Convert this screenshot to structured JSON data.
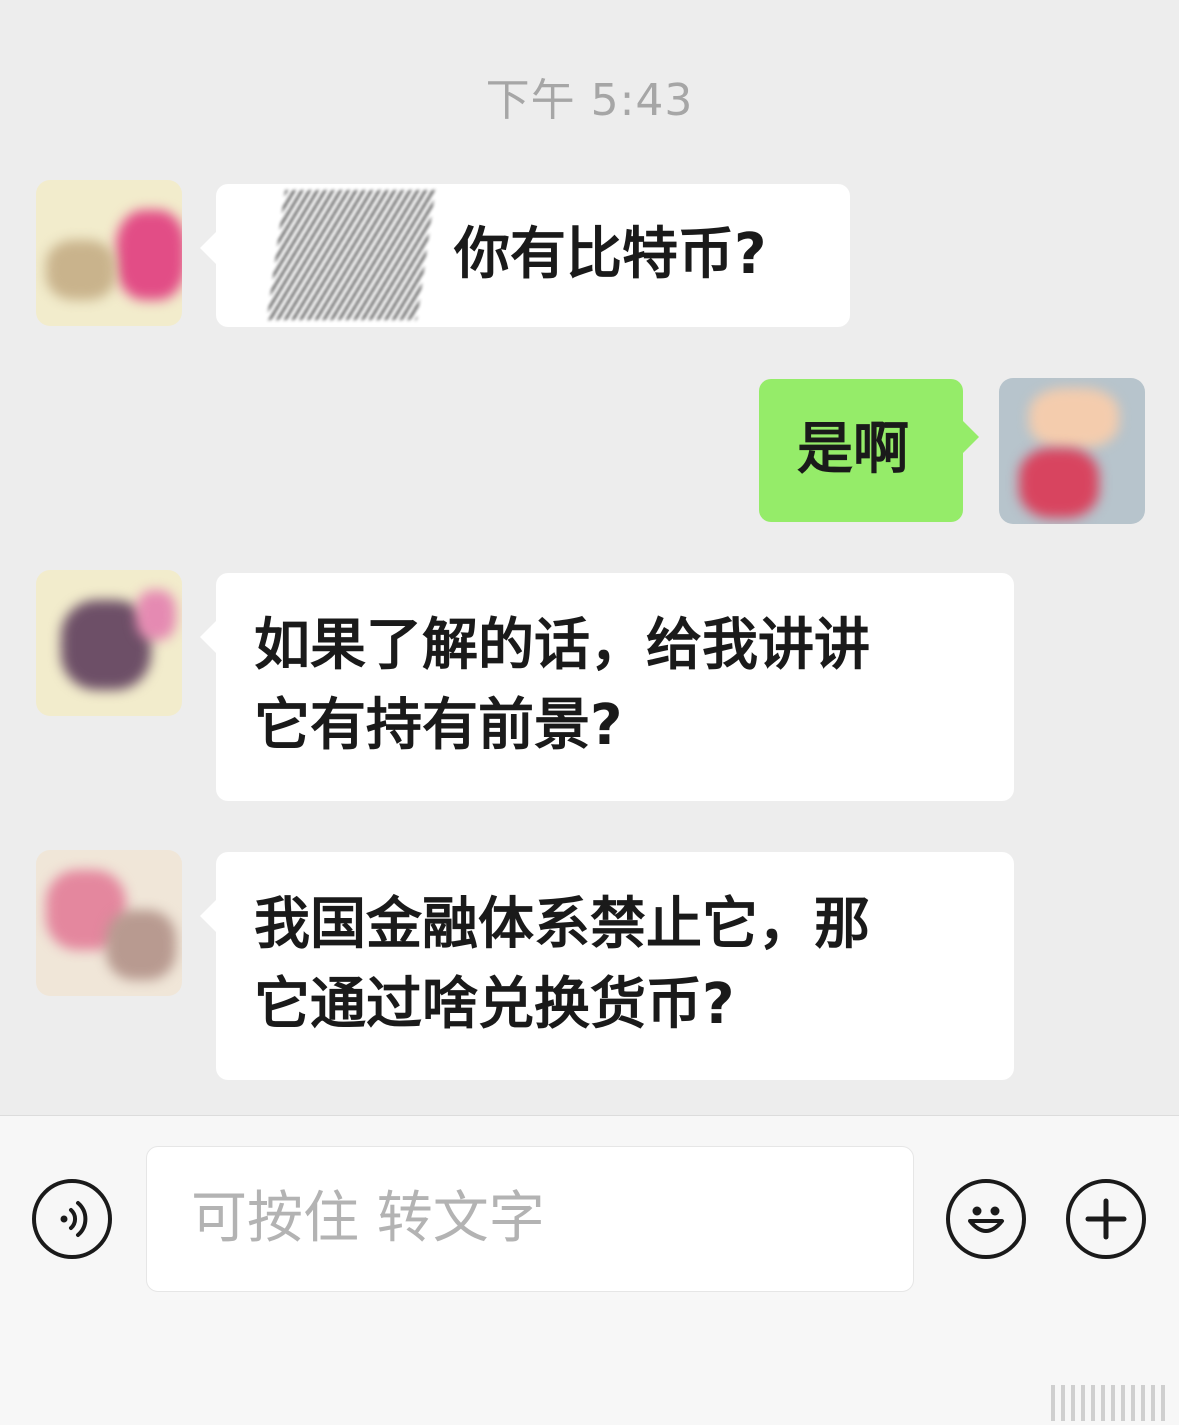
{
  "chat": {
    "timestamp": "下午 5:43",
    "messages": [
      {
        "side": "left",
        "lines": [
          "你有比特币?"
        ]
      },
      {
        "side": "right",
        "lines": [
          "是啊"
        ]
      },
      {
        "side": "left",
        "lines": [
          "如果了解的话，给我讲讲",
          "它有持有前景?"
        ]
      },
      {
        "side": "left",
        "lines": [
          "我国金融体系禁止它，那",
          "它通过啥兑换货币?"
        ]
      }
    ]
  },
  "input_bar": {
    "placeholder": "可按住 转文字",
    "icons": [
      "voice-icon",
      "emoji-icon",
      "plus-icon"
    ]
  },
  "colors": {
    "chat_background": "#ededed",
    "incoming_bubble": "#ffffff",
    "outgoing_bubble": "#95ec69",
    "timestamp_text": "#a6a6a6"
  }
}
